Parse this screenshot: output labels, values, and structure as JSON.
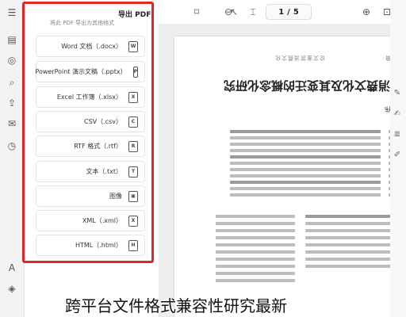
{
  "panel": {
    "title": "导出 PDF",
    "subtitle": "将此 PDF 导出为其他格式",
    "formats": [
      {
        "label": "Word 文档（.docx）",
        "icon": "word-file-icon",
        "glyph": "W"
      },
      {
        "label": "PowerPoint 演示文稿（.pptx）",
        "icon": "ppt-file-icon",
        "glyph": "P"
      },
      {
        "label": "Excel 工作簿（.xlsx）",
        "icon": "excel-file-icon",
        "glyph": "X"
      },
      {
        "label": "CSV（.csv）",
        "icon": "csv-file-icon",
        "glyph": "C"
      },
      {
        "label": "RTF 格式（.rtf）",
        "icon": "rtf-file-icon",
        "glyph": "R"
      },
      {
        "label": "文本（.txt）",
        "icon": "txt-file-icon",
        "glyph": "T"
      },
      {
        "label": "图像",
        "icon": "image-file-icon",
        "glyph": "▣"
      },
      {
        "label": "XML（.xml）",
        "icon": "xml-file-icon",
        "glyph": "X"
      },
      {
        "label": "HTML（.html）",
        "icon": "html-file-icon",
        "glyph": "H"
      }
    ]
  },
  "toolbar": {
    "page_current": "1",
    "page_sep": "/",
    "page_total": "5"
  },
  "document": {
    "running_header": "论文鉴赏消费文化",
    "running_header_right": "· 本刊稿 ·",
    "title": "消费文化及其变迁的概念化研究",
    "author": "·伟"
  },
  "caption": "跨平台文件格式兼容性研究最新",
  "colors": {
    "highlight_border": "#e02626",
    "doc_background": "#ededed"
  }
}
